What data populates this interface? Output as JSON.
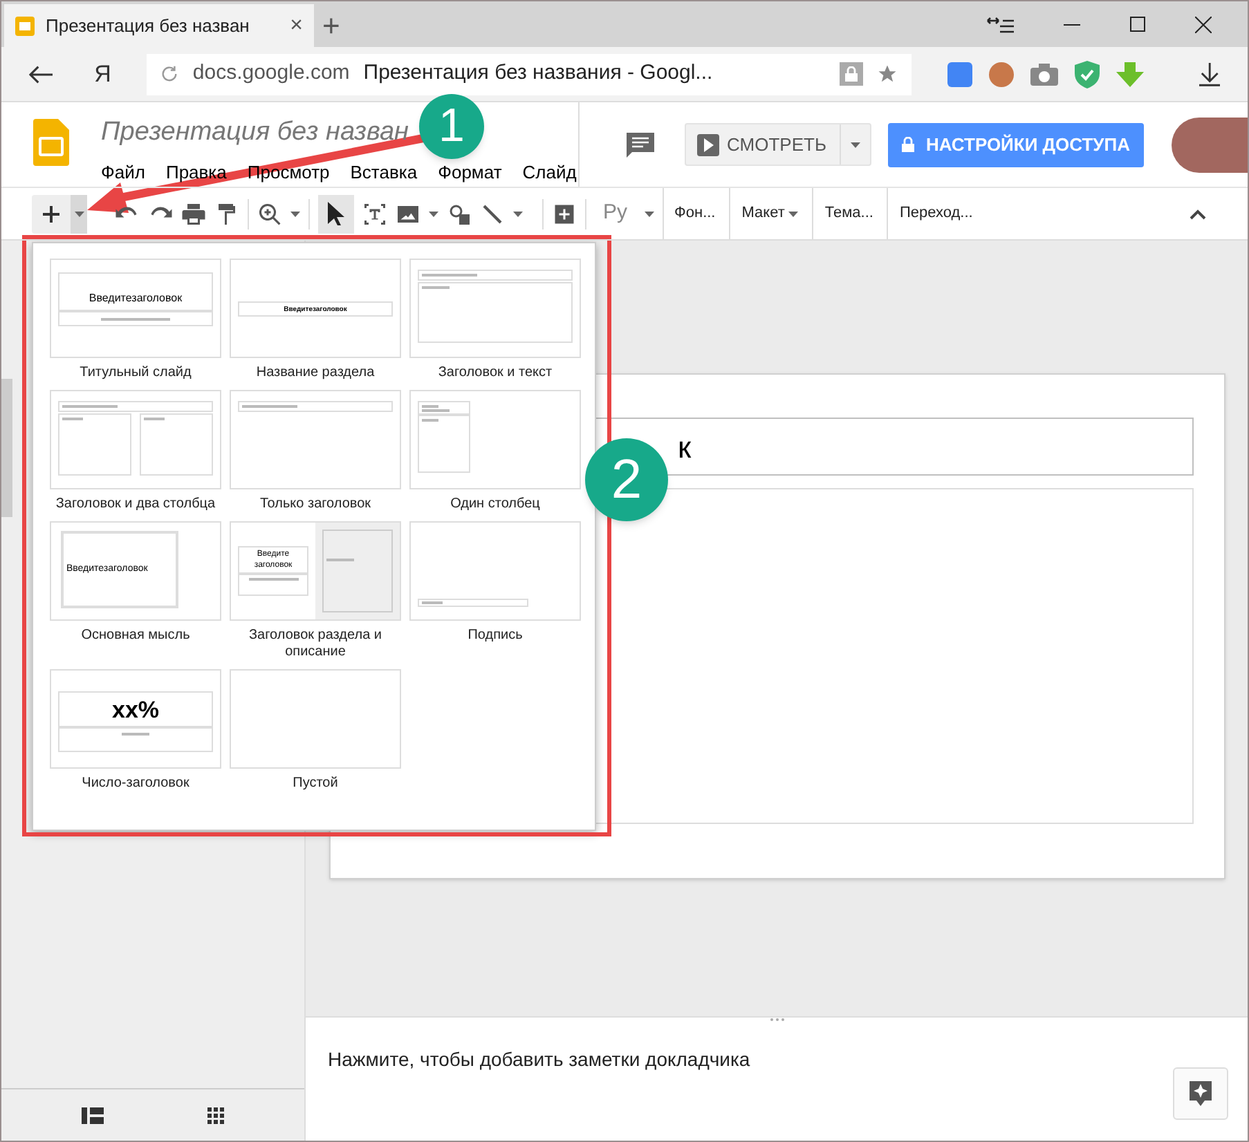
{
  "browser": {
    "tab": {
      "title": "Презентация без назван",
      "close": "×"
    },
    "new_tab": "+",
    "address": {
      "home": "Я",
      "domain": "docs.google.com",
      "page_title": "Презентация без названия - Googl..."
    }
  },
  "app": {
    "title": "Презентация без назван",
    "menu": [
      "Файл",
      "Правка",
      "Просмотр",
      "Вставка",
      "Формат",
      "Слайд"
    ],
    "present_button": "СМОТРЕТЬ",
    "share_button": "НАСТРОЙКИ ДОСТУПА"
  },
  "toolbar": {
    "input_tools": "Ру",
    "buttons": [
      {
        "label": "Фон...",
        "caret": false
      },
      {
        "label": "Макет",
        "caret": true
      },
      {
        "label": "Тема...",
        "caret": false
      },
      {
        "label": "Переход...",
        "caret": false
      }
    ]
  },
  "layouts": [
    {
      "name": "Титульный слайд",
      "kind": "title",
      "thumb_text": "Введитезаголовок"
    },
    {
      "name": "Название раздела",
      "kind": "section",
      "thumb_text": "Введитезаголовок"
    },
    {
      "name": "Заголовок и текст",
      "kind": "title_body"
    },
    {
      "name": "Заголовок и два столбца",
      "kind": "two_columns"
    },
    {
      "name": "Только заголовок",
      "kind": "title_only"
    },
    {
      "name": "Один столбец",
      "kind": "one_column"
    },
    {
      "name": "Основная мысль",
      "kind": "main_point",
      "thumb_text": "Введитезаголовок"
    },
    {
      "name": "Заголовок раздела и описание",
      "kind": "section_description",
      "thumb_text": "Введите заголовок"
    },
    {
      "name": "Подпись",
      "kind": "caption"
    },
    {
      "name": "Число-заголовок",
      "kind": "big_number",
      "thumb_text": "xx%"
    },
    {
      "name": "Пустой",
      "kind": "blank"
    }
  ],
  "slide": {
    "title": "к"
  },
  "notes": {
    "placeholder": "Нажмите, чтобы добавить заметки докладчика"
  },
  "annotations": [
    {
      "label": "1"
    },
    {
      "label": "2"
    }
  ]
}
